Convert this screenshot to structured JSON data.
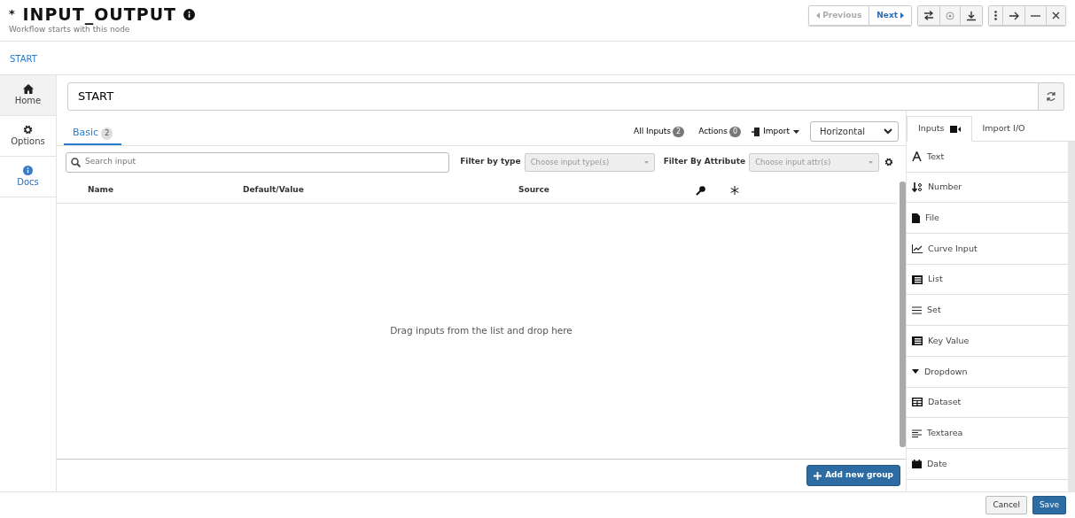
{
  "header": {
    "modified_mark": "*",
    "title": "INPUT_OUTPUT",
    "subtitle": "Workflow starts with this node"
  },
  "nav_buttons": [
    {
      "label": "Previous",
      "kind": "prev",
      "disabled": true
    },
    {
      "label": "Next",
      "kind": "next",
      "disabled": false
    }
  ],
  "breadcrumb": "START",
  "sidebar": [
    {
      "label": "Home",
      "kind": "home",
      "selected": true
    },
    {
      "label": "Options",
      "kind": "options",
      "selected": false
    },
    {
      "label": "Docs",
      "kind": "docs",
      "selected": false
    }
  ],
  "name_field": {
    "value": "START"
  },
  "tabs": [
    {
      "label": "Basic",
      "count": "2",
      "selected": true
    }
  ],
  "counters": [
    {
      "label": "All Inputs",
      "count": "2"
    },
    {
      "label": "Actions",
      "count": "0"
    }
  ],
  "import_button": "Import",
  "layout_select": {
    "value": "Horizontal"
  },
  "search": {
    "placeholder": "Search input"
  },
  "filters": [
    {
      "label": "Filter by type",
      "placeholder": "Choose input type(s)"
    },
    {
      "label": "Filter By Attribute",
      "placeholder": "Choose input attr(s)"
    }
  ],
  "table": {
    "columns": [
      "Name",
      "Default/Value",
      "Source"
    ]
  },
  "empty_message": "Drag inputs from the list and drop here",
  "add_group_button": "Add new group",
  "side_tabs": [
    {
      "label": "Inputs",
      "selected": true
    },
    {
      "label": "Import I/O",
      "selected": false
    }
  ],
  "input_types": [
    {
      "label": "Text",
      "kind": "text"
    },
    {
      "label": "Number",
      "kind": "number"
    },
    {
      "label": "File",
      "kind": "file"
    },
    {
      "label": "Curve Input",
      "kind": "curve"
    },
    {
      "label": "List",
      "kind": "list"
    },
    {
      "label": "Set",
      "kind": "set"
    },
    {
      "label": "Key Value",
      "kind": "keyvalue"
    },
    {
      "label": "Dropdown",
      "kind": "dropdown"
    },
    {
      "label": "Dataset",
      "kind": "dataset"
    },
    {
      "label": "Textarea",
      "kind": "textarea"
    },
    {
      "label": "Date",
      "kind": "date"
    }
  ],
  "footer_buttons": [
    {
      "label": "Cancel",
      "kind": "secondary"
    },
    {
      "label": "Save",
      "kind": "primary"
    }
  ]
}
